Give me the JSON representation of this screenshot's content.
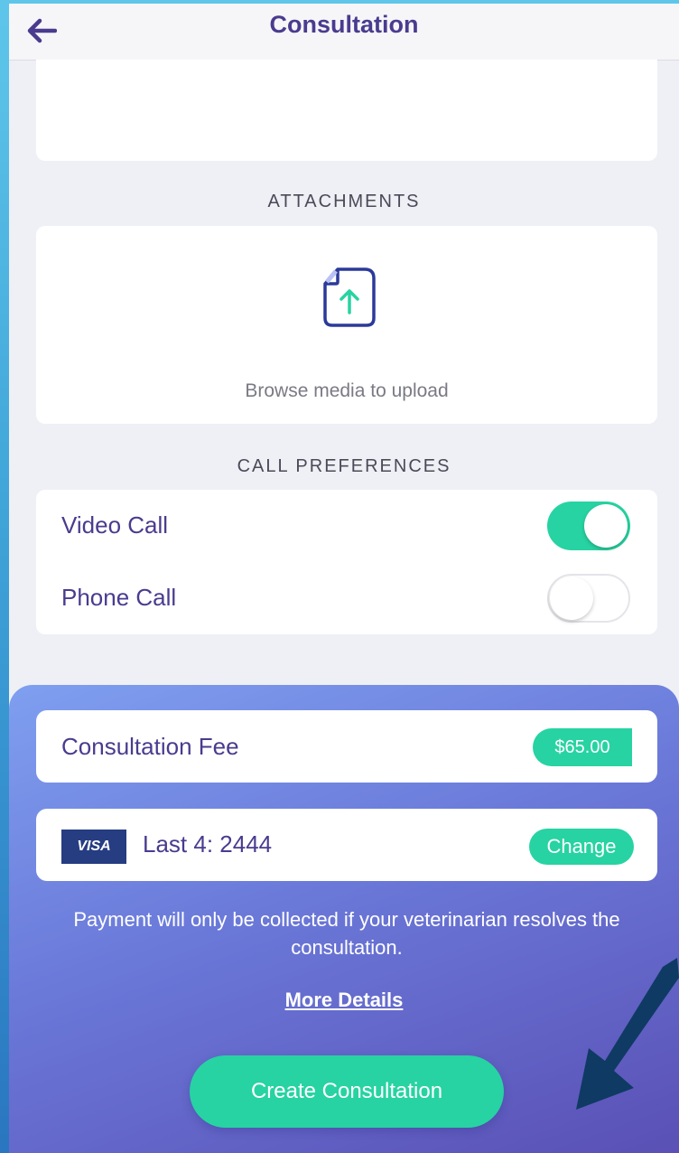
{
  "header": {
    "title": "Consultation"
  },
  "attachments": {
    "heading": "ATTACHMENTS",
    "upload_label": "Browse media to upload",
    "icon": "file-upload-icon"
  },
  "call_preferences": {
    "heading": "CALL PREFERENCES",
    "options": [
      {
        "label": "Video Call",
        "enabled": true
      },
      {
        "label": "Phone Call",
        "enabled": false
      }
    ]
  },
  "payment": {
    "fee_label": "Consultation Fee",
    "fee_amount": "$65.00",
    "card_brand": "VISA",
    "card_label": "Last 4: 2444",
    "change_label": "Change",
    "notice": "Payment will only be collected if your veterinarian resolves the consultation.",
    "more_details_label": "More Details",
    "create_button_label": "Create Consultation"
  },
  "colors": {
    "brand_purple": "#4a3b8f",
    "accent_green": "#27d3a2",
    "panel_gradient_start": "#7f9ff0",
    "panel_gradient_end": "#5a4fb4",
    "annotation_arrow": "#0f3a63"
  }
}
